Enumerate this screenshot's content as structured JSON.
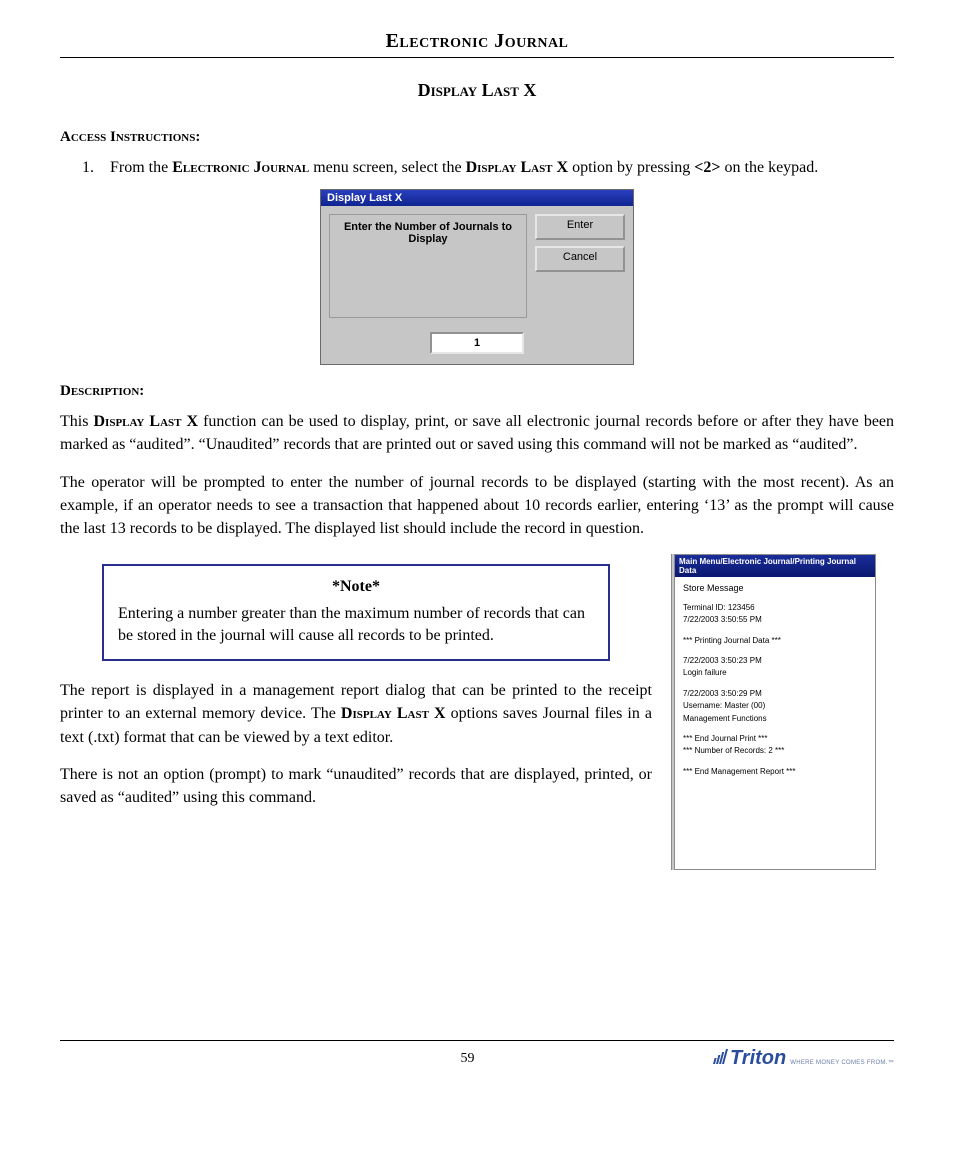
{
  "header": "Electronic Journal",
  "section_title": "Display Last X",
  "access": {
    "heading": "Access Instructions:",
    "items": [
      {
        "num": "1.",
        "pre": "From the ",
        "sc1": "Electronic Journal",
        "mid": " menu screen, select the ",
        "sc2": "Display Last X",
        "post": " option by pressing ",
        "key": "<2>",
        "tail": " on the keypad."
      }
    ]
  },
  "dialog": {
    "title": "Display Last X",
    "prompt": "Enter the Number of Journals to Display",
    "enter": "Enter",
    "cancel": "Cancel",
    "input_value": "1"
  },
  "description": {
    "heading": "Description:",
    "p1_pre": "This ",
    "p1_sc": "Display Last X",
    "p1_post": " function can be used to display, print, or save all electronic journal records before or after they have been marked as “audited”.  “Unaudited” records that are printed out or saved using this command will not be marked as “audited”.",
    "p2": "The operator will be prompted to enter the number of journal records to be displayed (starting with the most recent).  As an example, if an operator needs to see a transaction that happened about 10 records earlier, entering ‘13’ as the prompt will cause the last 13 records to be displayed. The displayed list should include the record in question.",
    "note_title": "*Note*",
    "note_body": "Entering a number greater than the maximum number of records that can be stored in the journal will cause all records to be printed.",
    "p3_pre": "The report is displayed in a management report dialog that can be printed to the receipt printer to an external memory device.  The ",
    "p3_sc": "Display Last X",
    "p3_post": " options saves Journal files in a text (.txt) format that can be viewed by a text editor.",
    "p4": "There is not an option (prompt) to mark “unaudited” records that are displayed, printed, or saved as “audited” using this command."
  },
  "report": {
    "title": "Main Menu/Electronic Journal/Printing Journal Data",
    "store": "Store Message",
    "lines": [
      "Terminal ID: 123456",
      "7/22/2003 3:50:55 PM",
      "",
      "*** Printing Journal Data ***",
      "",
      "7/22/2003 3:50:23 PM",
      "Login failure",
      "",
      "7/22/2003 3:50:29 PM",
      "Username: Master (00)",
      "Management Functions",
      "",
      "*** End Journal Print ***",
      "*** Number of Records: 2 ***",
      "",
      "*** End Management Report ***"
    ]
  },
  "footer": {
    "page": "59",
    "brand": "Triton",
    "tagline": "WHERE MONEY COMES FROM.™"
  }
}
